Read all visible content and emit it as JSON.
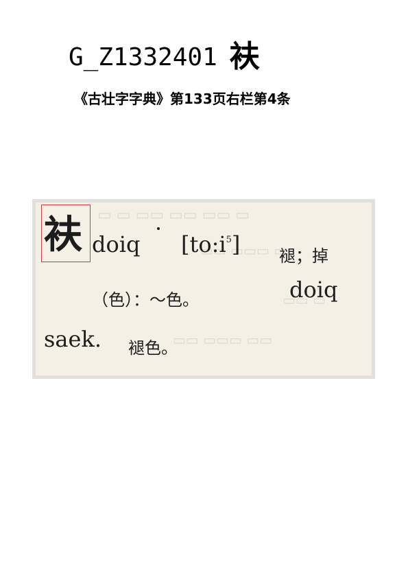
{
  "header": {
    "code": "G_Z1332401",
    "character": "衭"
  },
  "source": {
    "text": "《古壮字字典》第133页右栏第4条"
  },
  "entry": {
    "headword": "衭",
    "romanization": "doiq",
    "ipa_open": "[to:i",
    "ipa_tone": "5",
    "ipa_close": "]",
    "gloss_1": "褪；掉",
    "line2_gloss": "（色）：～色。",
    "line2_roman": "doiq",
    "line3_roman": "saek.",
    "line3_gloss": "褪色。"
  },
  "colors": {
    "highlight_box": "#d23a3a",
    "scan_paper": "#f4f0e6",
    "scan_frame": "#e2e0dc"
  }
}
